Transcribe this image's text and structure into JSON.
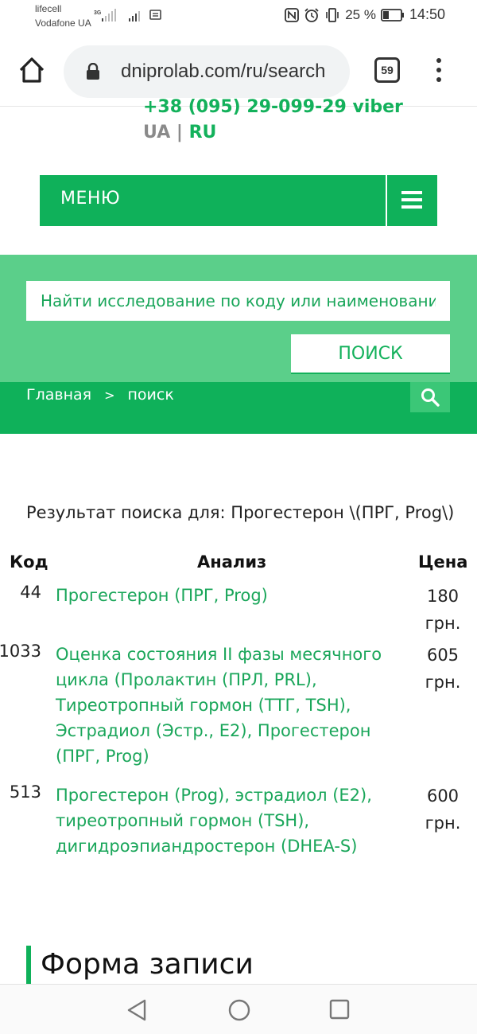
{
  "status_bar": {
    "carrier_1": "lifecell",
    "carrier_2": "Vodafone UA",
    "network_label": "3G",
    "battery_percent": "25 %",
    "time": "14:50"
  },
  "browser": {
    "url": "dniprolab.com/ru/search",
    "tab_count": "59"
  },
  "header": {
    "phone": "+38 (095) 29-099-29 viber",
    "lang_ua": "UA",
    "lang_sep": "|",
    "lang_ru": "RU"
  },
  "menu": {
    "label": "МЕНЮ"
  },
  "search": {
    "placeholder": "Найти исследование по коду или наименованию",
    "button_label": "ПОИСК"
  },
  "breadcrumb": {
    "home": "Главная",
    "separator": ">",
    "current": "поиск"
  },
  "results": {
    "title": "Результат поиска для: Прогестерон \\(ПРГ, Prog\\)",
    "columns": {
      "code": "Код",
      "name": "Анализ",
      "price": "Цена"
    },
    "rows": [
      {
        "code": "44",
        "name": "Прогестерон (ПРГ, Prog)",
        "price": "180 грн."
      },
      {
        "code": "1033",
        "name": "Оценка состояния II фазы месячного цикла (Пролактин (ПРЛ, PRL), Тиреотропный гормон (ТТГ, TSH), Эстрадиол (Эстр., E2), Прогестерон (ПРГ, Prog)",
        "price": "605 грн."
      },
      {
        "code": "513",
        "name": "Прогестерон (Prog), эстрадиол (E2), тиреотропный гормон (TSH), дигидроэпиандростерон (DHEA-S)",
        "price": "600 грн."
      }
    ]
  },
  "form": {
    "title": "Форма записи"
  },
  "colors": {
    "brand_green": "#0fb15a",
    "light_green": "#5bcf8a",
    "link_green": "#1aa65a"
  }
}
